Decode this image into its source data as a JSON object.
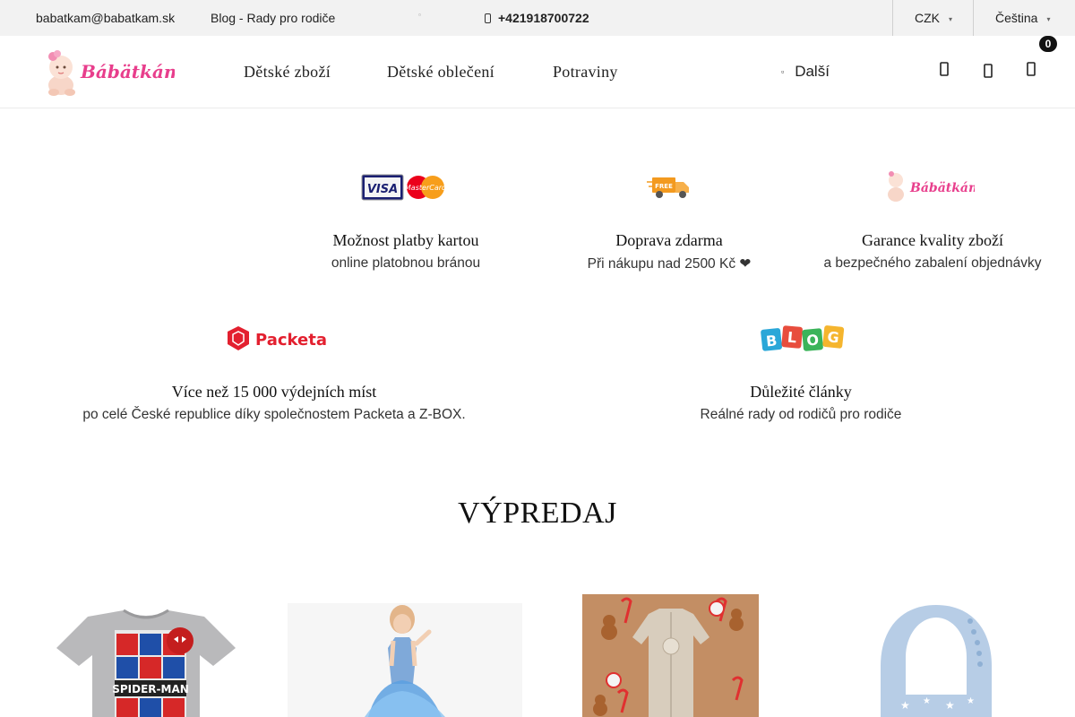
{
  "topbar": {
    "email": "babatkam@babatkam.sk",
    "blog_link": "Blog - Rady pro rodiče",
    "phone": "+421918700722",
    "currency": "CZK",
    "language": "Čeština"
  },
  "header": {
    "logo_text": "Bábätkám",
    "nav": [
      "Dětské zboží",
      "Dětské oblečení",
      "Potraviny"
    ],
    "more_label": "Další",
    "cart_count": "0"
  },
  "benefits": [
    {
      "title": "Možnost platby kartou",
      "subtitle": "online platobnou bránou",
      "icon": "visa-mastercard-icon"
    },
    {
      "title": "Doprava zdarma",
      "subtitle": "Při nákupu nad 2500 Kč ❤",
      "icon": "free-delivery-truck-icon",
      "icon_text": "FREE"
    },
    {
      "title": "Garance kvality zboží",
      "subtitle": "a bezpečného zabalení objednávky",
      "icon": "babatkam-logo-icon",
      "icon_text": "Bábätkám"
    },
    {
      "title": "Více než 15 000 výdejních míst",
      "subtitle": "po celé České republice díky společnostem Packeta a Z-BOX.",
      "icon": "packeta-logo-icon",
      "icon_text": "Packeta"
    },
    {
      "title": "Důležité články",
      "subtitle": "Reálné rady od rodičů pro rodiče",
      "icon": "blog-logo-icon",
      "icon_text": "BLOG"
    }
  ],
  "sale": {
    "title": "VÝPREDAJ"
  },
  "products": [
    {
      "image": "spiderman-tshirt",
      "print_text": "SPIDER-MAN"
    },
    {
      "image": "girl-blue-tutu-dress"
    },
    {
      "image": "beige-baby-sleepsuit-gingerbread"
    },
    {
      "image": "light-blue-silicone-bib"
    }
  ],
  "colors": {
    "brand_pink": "#e83e8c",
    "packeta_red": "#e3202f",
    "truck_orange": "#f39a1f",
    "topbar_bg": "#f2f2f2"
  }
}
